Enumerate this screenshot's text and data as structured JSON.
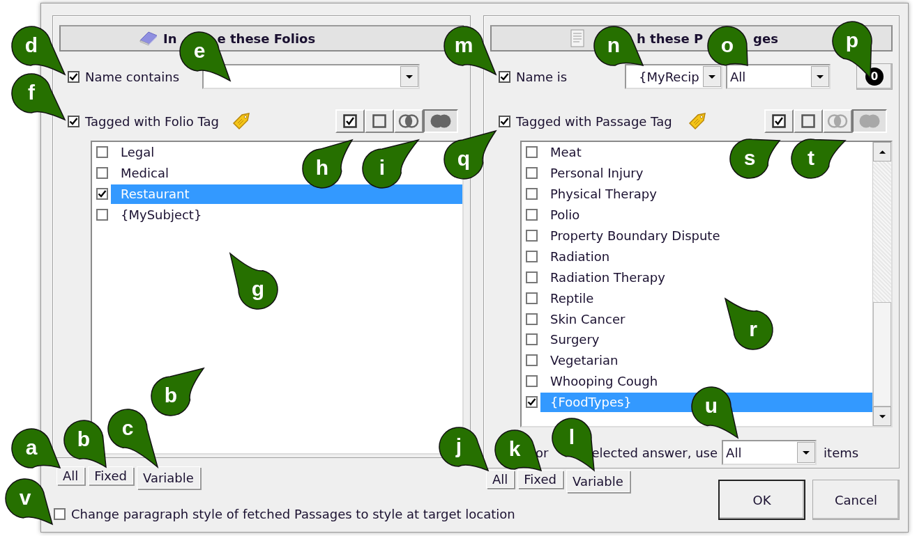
{
  "left_panel": {
    "header": [
      "In",
      "e these Folios"
    ],
    "name_filter": {
      "checked": true,
      "label": "Name contains"
    },
    "tag_filter": {
      "checked": true,
      "label": "Tagged with Folio Tag"
    },
    "tag_buttons": [
      {
        "kind": "check",
        "selected": false,
        "disabled": false
      },
      {
        "kind": "uncheck",
        "selected": false,
        "disabled": false
      },
      {
        "kind": "intersect",
        "selected": false,
        "disabled": false
      },
      {
        "kind": "union",
        "selected": true,
        "disabled": false
      }
    ],
    "tags": [
      {
        "label": "Legal",
        "checked": false,
        "selected": false
      },
      {
        "label": "Medical",
        "checked": false,
        "selected": false
      },
      {
        "label": "Restaurant",
        "checked": true,
        "selected": true
      },
      {
        "label": "{MySubject}",
        "checked": false,
        "selected": false
      }
    ],
    "tabs": [
      {
        "label": "All",
        "selected": false
      },
      {
        "label": "Fixed",
        "selected": false
      },
      {
        "label": "Variable",
        "selected": true
      }
    ]
  },
  "right_panel": {
    "header": [
      "h these P",
      "ges"
    ],
    "name_filter": {
      "checked": true,
      "label": "Name is",
      "value": "{MyRecip",
      "scope": "All",
      "count_button": "0"
    },
    "tag_filter": {
      "checked": true,
      "label": "Tagged with Passage Tag"
    },
    "tag_buttons": [
      {
        "kind": "check",
        "selected": false,
        "disabled": false
      },
      {
        "kind": "uncheck",
        "selected": false,
        "disabled": false
      },
      {
        "kind": "intersect",
        "selected": false,
        "disabled": true
      },
      {
        "kind": "union",
        "selected": true,
        "disabled": true
      }
    ],
    "tags": [
      {
        "label": "Meat",
        "checked": false,
        "selected": false
      },
      {
        "label": "Personal Injury",
        "checked": false,
        "selected": false
      },
      {
        "label": "Physical Therapy",
        "checked": false,
        "selected": false
      },
      {
        "label": "Polio",
        "checked": false,
        "selected": false
      },
      {
        "label": "Property Boundary Dispute",
        "checked": false,
        "selected": false
      },
      {
        "label": "Radiation",
        "checked": false,
        "selected": false
      },
      {
        "label": "Radiation Therapy",
        "checked": false,
        "selected": false
      },
      {
        "label": "Reptile",
        "checked": false,
        "selected": false
      },
      {
        "label": "Skin Cancer",
        "checked": false,
        "selected": false
      },
      {
        "label": "Surgery",
        "checked": false,
        "selected": false
      },
      {
        "label": "Vegetarian",
        "checked": false,
        "selected": false
      },
      {
        "label": "Whooping Cough",
        "checked": false,
        "selected": false
      },
      {
        "label": "{FoodTypes}",
        "checked": true,
        "selected": true
      }
    ],
    "answer_row": {
      "label_parts": [
        "or",
        "elected answer, use"
      ],
      "value": "All",
      "suffix": "items"
    },
    "tabs": [
      {
        "label": "All",
        "selected": false
      },
      {
        "label": "Fixed",
        "selected": false
      },
      {
        "label": "Variable",
        "selected": true
      }
    ]
  },
  "restyle_option": {
    "checked": false,
    "label": "Change paragraph style of fetched Passages to style at target location"
  },
  "buttons": [
    "OK",
    "Cancel"
  ],
  "callouts": [
    "d",
    "e",
    "m",
    "n",
    "o",
    "p",
    "f",
    "h",
    "i",
    "q",
    "s",
    "t",
    "g",
    "r",
    "b",
    "u",
    "a",
    "b",
    "c",
    "j",
    "k",
    "l",
    "v"
  ]
}
